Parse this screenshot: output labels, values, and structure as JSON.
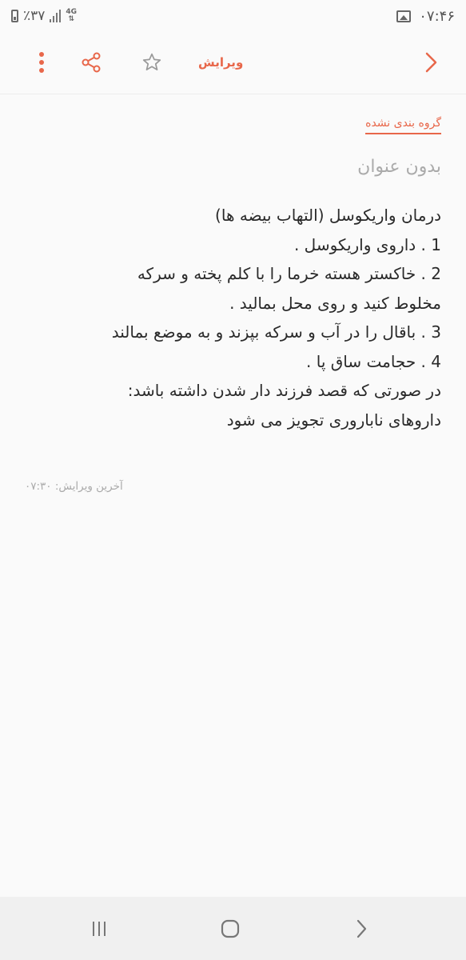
{
  "status_bar": {
    "battery_percent": "٪۳۷",
    "network_type": "4G",
    "time": "۰۷:۴۶"
  },
  "toolbar": {
    "edit_label": "ویرایش",
    "icons": [
      "more-vertical-icon",
      "share-icon",
      "star-icon",
      "chevron-right-icon"
    ]
  },
  "note": {
    "category": "گروه بندی نشده",
    "title": "بدون عنوان",
    "lines": [
      "درمان واریکوسل (التهاب بیضه ها)",
      "1 . داروی واریکوسل .",
      "2 . خاکستر هسته خرما را با کلم پخته و سرکه",
      "مخلوط کنید و روی محل بمالید .",
      "3 . باقال را در آب و سرکه بپزند و به موضع بمالند",
      "4 . حجامت ساق پا .",
      "در صورتی که قصد فرزند دار شدن داشته باشد:",
      "داروهای ناباروری تجویز می شود"
    ],
    "last_edit": "آخرین ویرایش: ۰۷:۳۰"
  },
  "colors": {
    "accent": "#e8674a",
    "background": "#fafafa",
    "nav_bar": "#f0f0f0"
  }
}
